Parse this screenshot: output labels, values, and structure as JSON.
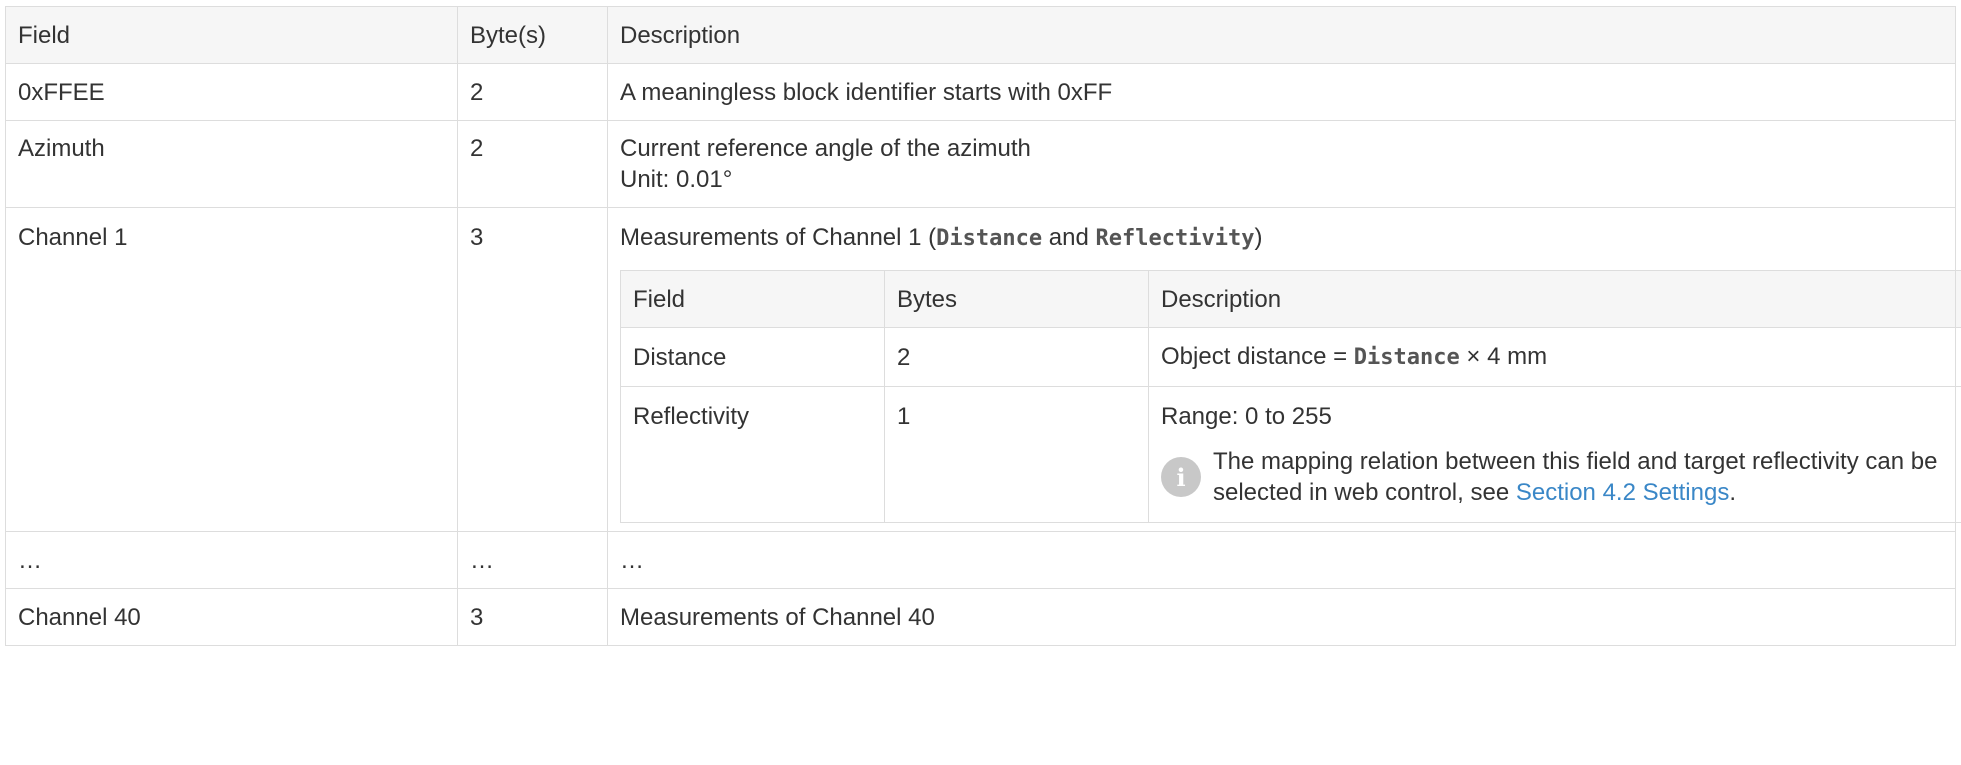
{
  "main_table": {
    "headers": [
      "Field",
      "Byte(s)",
      "Description"
    ],
    "rows": [
      {
        "field": "0xFFEE",
        "bytes": "2",
        "description": "A meaningless block identifier starts with 0xFF"
      },
      {
        "field": "Azimuth",
        "bytes": "2",
        "description_line1": "Current reference angle of the azimuth",
        "description_line2": "Unit: 0.01°"
      },
      {
        "field": "Channel 1",
        "bytes": "3",
        "desc_prefix": "Measurements of Channel 1 (",
        "desc_code1": "Distance",
        "desc_and": " and ",
        "desc_code2": "Reflectivity",
        "desc_suffix": ")"
      },
      {
        "field": "…",
        "bytes": "…",
        "description": "…"
      },
      {
        "field": "Channel 40",
        "bytes": "3",
        "description": "Measurements of Channel 40"
      }
    ]
  },
  "sub_table": {
    "headers": [
      "Field",
      "Bytes",
      "Description"
    ],
    "rows": [
      {
        "field": "Distance",
        "bytes": "2",
        "desc_prefix": "Object distance = ",
        "desc_code": "Distance",
        "desc_suffix": " × 4 mm"
      },
      {
        "field": "Reflectivity",
        "bytes": "1",
        "description": "Range: 0 to 255"
      }
    ]
  },
  "note": {
    "icon": "info-icon",
    "icon_glyph": "i",
    "text": "The mapping relation between this field and target reflectivity can be selected in web control, see ",
    "link_text": "Section 4.2 Settings",
    "suffix": "."
  },
  "colors": {
    "border": "#dddddd",
    "header_bg": "#f6f6f6",
    "text": "#333333",
    "link": "#3a87c7",
    "icon_bg": "#c8c8c8"
  }
}
